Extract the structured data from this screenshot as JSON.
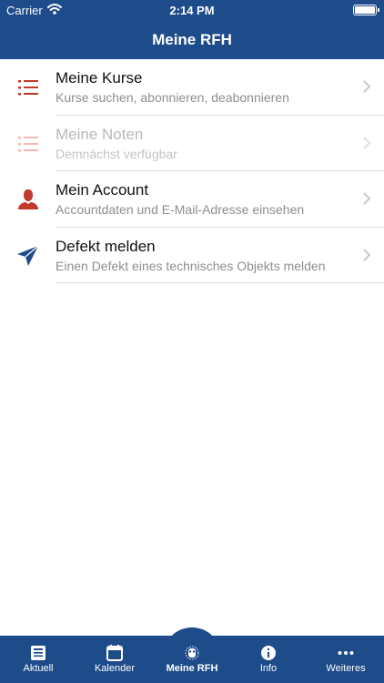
{
  "status_bar": {
    "carrier": "Carrier",
    "time": "2:14 PM"
  },
  "nav": {
    "title": "Meine RFH"
  },
  "menu": [
    {
      "title": "Meine Kurse",
      "subtitle": "Kurse suchen, abonnieren, deabonnieren",
      "icon": "list-icon",
      "enabled": true
    },
    {
      "title": "Meine Noten",
      "subtitle": "Demnächst verfügbar",
      "icon": "list-icon",
      "enabled": false
    },
    {
      "title": "Mein Account",
      "subtitle": "Accountdaten und E-Mail-Adresse einsehen",
      "icon": "person-icon",
      "enabled": true
    },
    {
      "title": "Defekt melden",
      "subtitle": "Einen Defekt eines technisches Objekts melden",
      "icon": "send-icon",
      "enabled": true
    }
  ],
  "tabs": [
    {
      "label": "Aktuell",
      "icon": "news-icon"
    },
    {
      "label": "Kalender",
      "icon": "calendar-icon"
    },
    {
      "label": "Meine RFH",
      "icon": "owl-icon",
      "active": true
    },
    {
      "label": "Info",
      "icon": "info-icon"
    },
    {
      "label": "Weiteres",
      "icon": "more-icon"
    }
  ],
  "colors": {
    "bar": "#1e4b8a",
    "accent_red": "#c0392b",
    "accent_blue": "#1e4b8a",
    "disabled_red": "#f0b9b3"
  }
}
